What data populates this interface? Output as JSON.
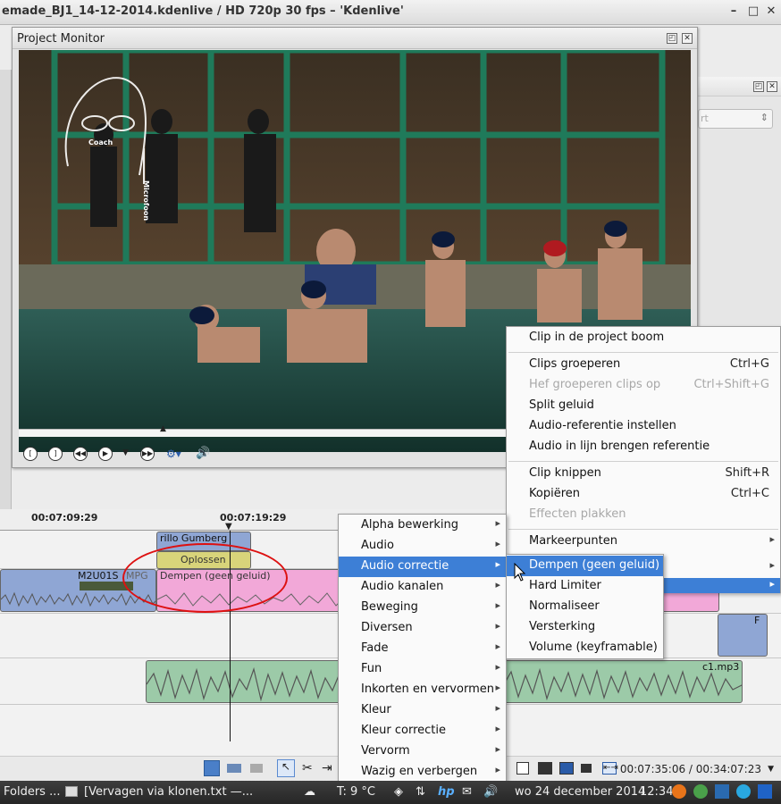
{
  "window": {
    "title": "emade_BJ1_14-12-2014.kdenlive / HD 720p 30 fps – 'Kdenlive'",
    "controls": [
      "–",
      "□",
      "✕"
    ]
  },
  "right_panel": {
    "combo_text": "rt"
  },
  "project_monitor": {
    "title": "Project Monitor",
    "overlay": {
      "coach": "Coach",
      "microphone": "Microfoon"
    },
    "controls": [
      "zone-start-icon",
      "zone-end-icon",
      "rewind-icon",
      "play-icon",
      "dropdown-icon",
      "forward-icon",
      "settings-icon",
      "volume-icon"
    ]
  },
  "timeline": {
    "ruler": [
      "00:07:09:29",
      "00:07:19:29"
    ],
    "clips": {
      "top_clip": "rillo Gumberg",
      "transition": "Oplossen",
      "video_left": "M2U01S",
      "video_left_sub": "MPG",
      "effect_clip": "Dempen (geen geluid)",
      "audio": "c1.mp3",
      "right_small": "F"
    },
    "timecode": "00:07:35:06 / 00:34:07:23"
  },
  "context_menu": {
    "items": [
      {
        "label": "Clip in de project boom",
        "shortcut": "",
        "disabled": false
      },
      {
        "label": "Clips groeperen",
        "shortcut": "Ctrl+G",
        "disabled": false
      },
      {
        "label": "Hef groeperen clips op",
        "shortcut": "Ctrl+Shift+G",
        "disabled": true
      },
      {
        "label": "Split geluid",
        "shortcut": "",
        "disabled": false
      },
      {
        "label": "Audio-referentie instellen",
        "shortcut": "",
        "disabled": false
      },
      {
        "label": "Audio in lijn brengen referentie",
        "shortcut": "",
        "disabled": false
      },
      {
        "label": "Clip knippen",
        "shortcut": "Shift+R",
        "disabled": false
      },
      {
        "label": "Kopiëren",
        "shortcut": "Ctrl+C",
        "disabled": false
      },
      {
        "label": "Effecten plakken",
        "shortcut": "",
        "disabled": true
      },
      {
        "label": "Markeerpunten",
        "shortcut": "",
        "disabled": false
      }
    ]
  },
  "effects_menu": {
    "items": [
      "Alpha bewerking",
      "Audio",
      "Audio correctie",
      "Audio kanalen",
      "Beweging",
      "Diversen",
      "Fade",
      "Fun",
      "Inkorten en vervormen",
      "Kleur",
      "Kleur correctie",
      "Vervorm",
      "Wazig en verbergen"
    ],
    "highlighted": "Audio correctie"
  },
  "audio_correction_menu": {
    "items": [
      "Dempen (geen geluid)",
      "Hard Limiter",
      "Normaliseer",
      "Versterking",
      "Volume (keyframable)"
    ],
    "highlighted": "Dempen (geen geluid)"
  },
  "taskbar": {
    "folders": "Folders ...",
    "window": "[Vervagen via klonen.txt —...",
    "weather": "T: 9 °C",
    "date": "wo 24 december 2014",
    "time": "12:34"
  },
  "colors": {
    "highlight": "#3d7fd6",
    "annotation_red": "#dd1111",
    "video_clip": "#8fa6d4",
    "effect_clip": "#f2a8d8",
    "audio_clip": "#9ccaa8",
    "transition": "#d8d47a"
  }
}
